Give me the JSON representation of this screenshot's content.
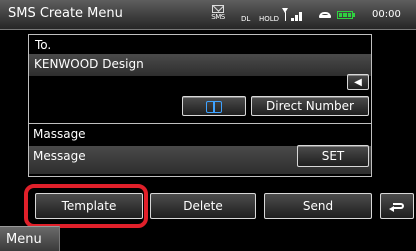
{
  "header": {
    "title": "SMS Create Menu",
    "status": {
      "sms_label": "SMS",
      "dl_label": "DL",
      "hold_label": "HOLD",
      "clock": "00:00",
      "signal_level": 3,
      "battery_level": 3
    }
  },
  "form": {
    "to_label": "To.",
    "to_value": "KENWOOD Design",
    "back_icon": "backspace-icon",
    "phonebook_icon": "book-icon",
    "direct_number_label": "Direct Number",
    "message_label": "Massage",
    "message_value": "Message",
    "set_label": "SET"
  },
  "actions": {
    "template_label": "Template",
    "delete_label": "Delete",
    "send_label": "Send",
    "return_icon": "return-icon",
    "highlight_color": "#e0202a"
  },
  "menu": {
    "label": "Menu"
  }
}
